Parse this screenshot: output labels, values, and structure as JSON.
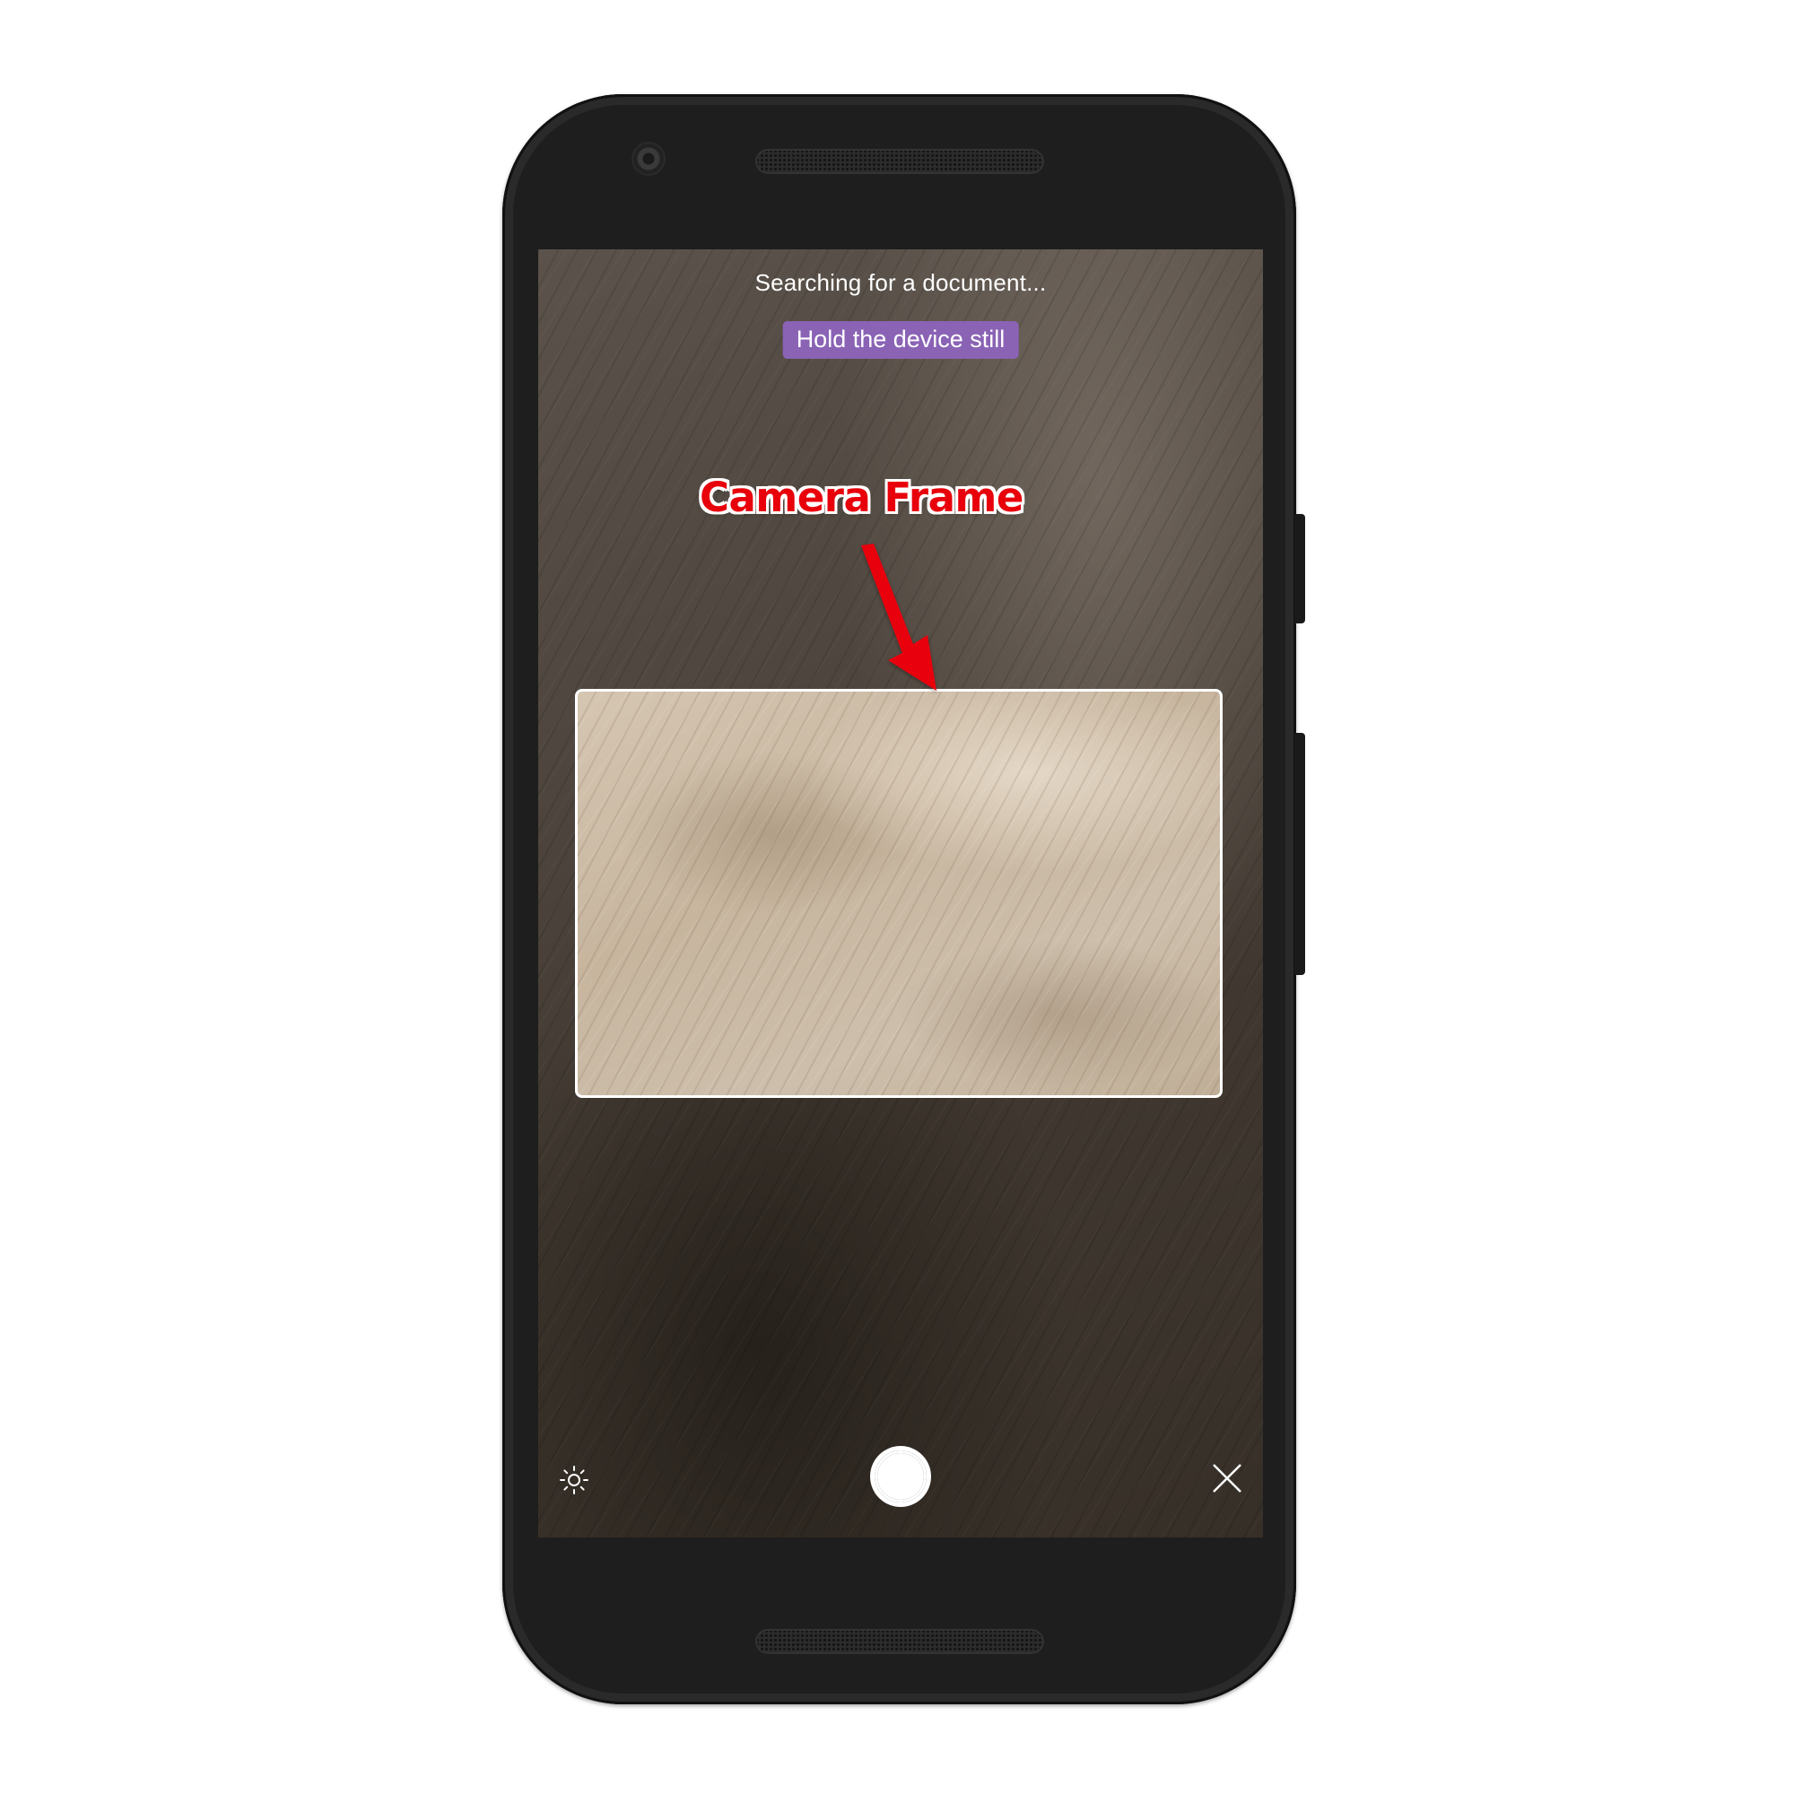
{
  "scanner": {
    "status_text": "Searching for a document...",
    "hint_badge": "Hold the device still",
    "hint_badge_color": "#8a63b5"
  },
  "controls": {
    "brightness_icon": "brightness-icon",
    "shutter_icon": "shutter-icon",
    "close_icon": "close-icon"
  },
  "annotation": {
    "label": "Camera Frame",
    "color": "#e8000b"
  }
}
